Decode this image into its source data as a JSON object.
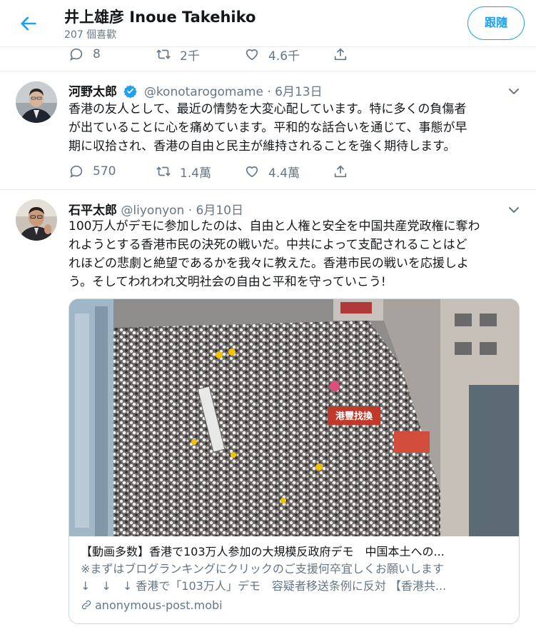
{
  "header": {
    "title": "井上雄彦 Inoue Takehiko",
    "subtitle": "207 個喜歡",
    "follow_label": "跟隨"
  },
  "top_actions": {
    "reply_count": "8",
    "retweet_count": "2千",
    "like_count": "4.6千"
  },
  "tweets": [
    {
      "name": "河野太郎",
      "verified": true,
      "handle": "@konotarogomame",
      "date": "· 6月13日",
      "lines": [
        "香港の友人として、最近の情勢を大変心配しています。特に多くの負傷者",
        "が出ていることに心を痛めています。平和的な話合いを通じて、事態が早",
        "期に収拾され、香港の自由と民主が維持されることを強く期待します。"
      ],
      "reply_count": "570",
      "retweet_count": "1.4萬",
      "like_count": "4.4萬"
    },
    {
      "name": "石平太郎",
      "handle": "@liyonyon",
      "date": "· 6月10日",
      "lines": [
        "100万人がデモに参加したのは、自由と人権と安全を中国共産党政権に奪わ",
        "れようとする香港市民の決死の戦いだ。中共によって支配されることはど",
        "れほどの悲劇と絶望であるかを我々に教えた。香港市民の戦いを応援しよ",
        "う。そしてわれわれ文明社会の自由と平和を守っていこう!"
      ],
      "card": {
        "sign_text": "港豐找換",
        "title": "【動画多数】香港で103万人参加の大規模反政府デモ　中国本土への...",
        "description_1": "※まずはブログランキングにクリックのご支援何卒宜しくお願いします",
        "description_2": "↓　↓　↓ 香港で「103万人」デモ　容疑者移送条例に反対 【香港共...",
        "domain": "anonymous-post.mobi"
      }
    }
  ],
  "colors": {
    "accent": "#1da1f2",
    "muted": "#657786",
    "divider": "#e6ecf0"
  }
}
